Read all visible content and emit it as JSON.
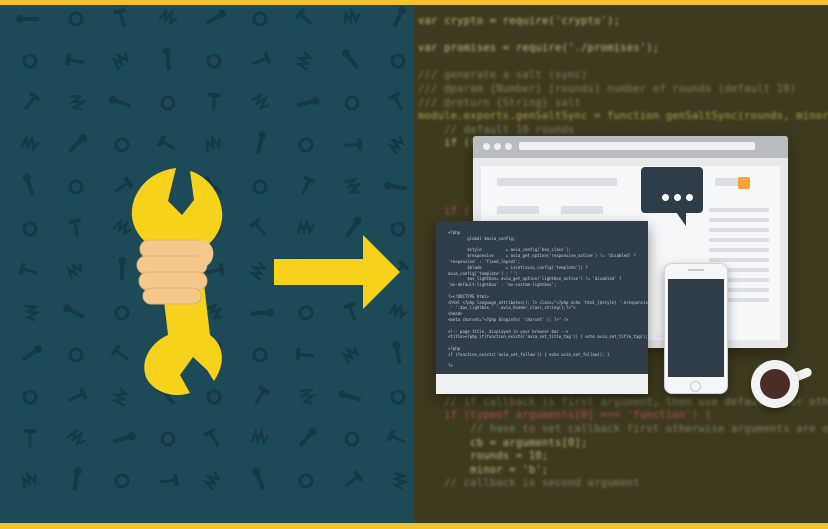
{
  "colors": {
    "border": "#f2c12e",
    "left_panel": "#1c4a56",
    "right_panel": "#3e3a1f",
    "accent_yellow": "#f6d21c",
    "hand": "#f3c98b"
  },
  "icons": {
    "pattern": "tools-pattern",
    "wrench": "wrench-icon",
    "hand": "hand-icon",
    "arrow": "arrow-right-icon",
    "browser": "browser-window-icon",
    "chat": "chat-bubble-icon",
    "editor": "code-editor-icon",
    "phone": "smartphone-icon",
    "coffee": "coffee-cup-icon"
  },
  "background_code": [
    {
      "text": "var crypto = require('crypto');",
      "tone": "w"
    },
    {
      "text": "",
      "tone": "w"
    },
    {
      "text": "var promises = require('./promises');",
      "tone": "w"
    },
    {
      "text": "",
      "tone": "w"
    },
    {
      "text": "/// generate a salt (sync)",
      "tone": "g"
    },
    {
      "text": "/// @param {Number} [rounds] number of rounds (default 10)",
      "tone": "g"
    },
    {
      "text": "/// @return {String} salt",
      "tone": "g"
    },
    {
      "text": "module.exports.genSaltSync = function genSaltSync(rounds, minor)",
      "tone": "y"
    },
    {
      "text": "    // default 10 rounds",
      "tone": "g"
    },
    {
      "text": "    if (!rounds) {",
      "tone": "w"
    },
    {
      "text": "",
      "tone": "w"
    },
    {
      "text": "",
      "tone": "w"
    },
    {
      "text": "",
      "tone": "w"
    },
    {
      "text": "",
      "tone": "w"
    },
    {
      "text": "    if (",
      "tone": "r"
    },
    {
      "text": "",
      "tone": "w"
    },
    {
      "text": "",
      "tone": "w"
    },
    {
      "text": "",
      "tone": "w"
    },
    {
      "text": "",
      "tone": "w"
    },
    {
      "text": "",
      "tone": "w"
    },
    {
      "text": "",
      "tone": "w"
    },
    {
      "text": "",
      "tone": "w"
    },
    {
      "text": "",
      "tone": "w"
    },
    {
      "text": "",
      "tone": "w"
    },
    {
      "text": "",
      "tone": "w"
    },
    {
      "text": "",
      "tone": "w"
    },
    {
      "text": "    var error;",
      "tone": "w"
    },
    {
      "text": "",
      "tone": "w"
    },
    {
      "text": "    // if callback is first argument, then use defaults for others",
      "tone": "g"
    },
    {
      "text": "    if (typeof arguments[0] === 'function') {",
      "tone": "r"
    },
    {
      "text": "        // have to set callback first otherwise arguments are overriden",
      "tone": "g"
    },
    {
      "text": "        cb = arguments[0];",
      "tone": "w"
    },
    {
      "text": "        rounds = 10;",
      "tone": "w"
    },
    {
      "text": "        minor = 'b';",
      "tone": "w"
    },
    {
      "text": "    // callback is second argument",
      "tone": "g"
    }
  ],
  "editor_lines": [
    "<?php",
    "        global $avia_config;",
    "",
    "        $style          = avia_config['box_class'];",
    "        $responsive     = avia_get_option('responsive_active') != 'disabled' ?",
    "'responsive' : 'fixed_layout';",
    "        $blank          = isset(avia_config['template']) ?",
    "avia_config['template'] : '';",
    "        $av_lightbox= avia_get_option('lightbox_active') != 'disabled' ?",
    "'av-default-lightbox' : 'av-custom-lightbox';",
    "",
    "?><!DOCTYPE html>",
    "<html <?php language_attributes(); ?> class=\"<?php echo 'html_{$style} '.$responsive",
    ".' '.$av_lightbox.' '.avia_header_class_string();?>\">",
    "<head>",
    "<meta charset=\"<?php bloginfo( 'charset' ); ?>\" />",
    "",
    "<!-- page title, displayed in your browser bar -->",
    "<title><?php if(function_exists('avia_set_title_tag')) { echo avia_set_title_tag(); } ?></title>",
    "",
    "<?php",
    "if (function_exists('avia_set_follow')) { echo avia_set_follow(); }",
    "",
    "?>"
  ]
}
